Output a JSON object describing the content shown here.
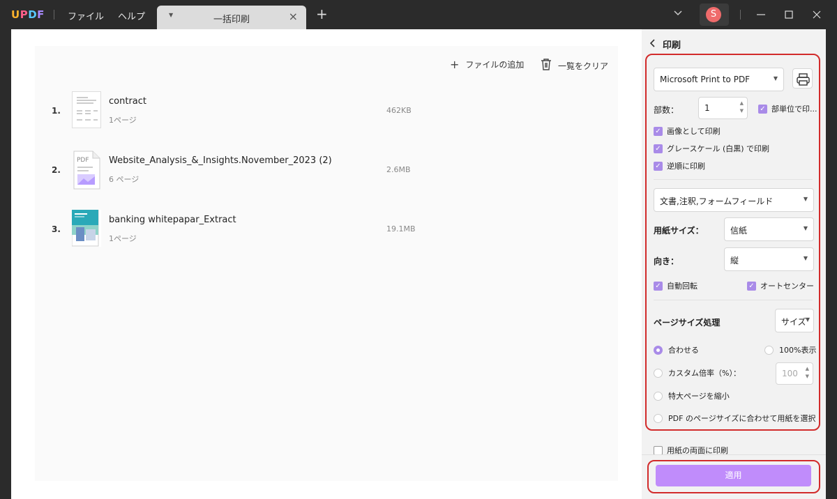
{
  "app": {
    "logo": "UPDF"
  },
  "menu": {
    "file": "ファイル",
    "help": "ヘルプ"
  },
  "tab": {
    "title": "一括印刷"
  },
  "user": {
    "initial": "S"
  },
  "toolbar": {
    "add_file": "ファイルの追加",
    "clear_list": "一覧をクリア"
  },
  "files": [
    {
      "index": "1.",
      "name": "contract",
      "pages": "1ページ",
      "size": "462KB"
    },
    {
      "index": "2.",
      "name": "Website_Analysis_&_Insights.November_2023 (2)",
      "pages": "6 ページ",
      "size": "2.6MB"
    },
    {
      "index": "3.",
      "name": "banking whitepapar_Extract",
      "pages": "1ページ",
      "size": "19.1MB"
    }
  ],
  "print": {
    "title": "印刷",
    "printer": "Microsoft Print to PDF",
    "copies_label": "部数：",
    "copies_value": "1",
    "collate": "部単位で印...",
    "as_image": "画像として印刷",
    "grayscale": "グレースケール (白黒) で印刷",
    "reverse": "逆順に印刷",
    "content": "文書,注釈,フォームフィールド",
    "paper_size_label": "用紙サイズ：",
    "paper_size": "信紙",
    "orientation_label": "向き：",
    "orientation": "縦",
    "auto_rotate": "自動回転",
    "auto_center": "オートセンター",
    "page_sizing_label": "ページサイズ処理",
    "page_sizing": "サイズ",
    "fit": "合わせる",
    "actual": "100%表示",
    "custom_scale": "カスタム倍率（%）：",
    "custom_scale_value": "100",
    "shrink": "特大ページを縮小",
    "choose_paper": "PDF のページサイズに合わせて用紙を選択",
    "duplex": "用紙の両面に印刷",
    "apply": "適用"
  },
  "colors": {
    "accent": "#a98be8",
    "apply": "#c08cfb",
    "highlight": "#d22b2b"
  }
}
